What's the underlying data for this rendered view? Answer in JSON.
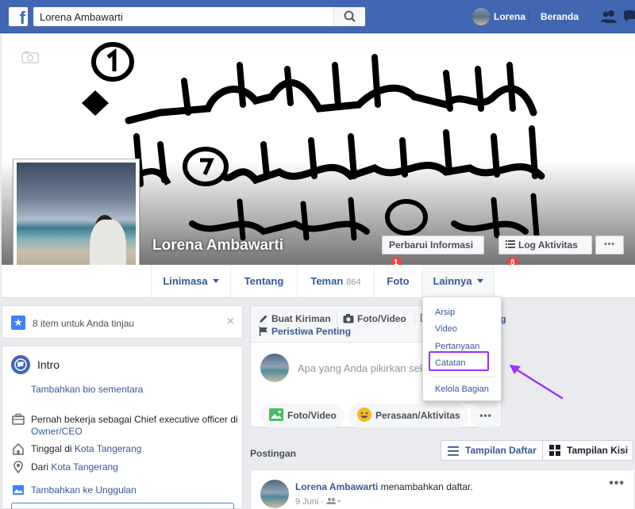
{
  "topbar": {
    "logo": "f",
    "search_value": "Lorena Ambawarti",
    "user_name": "Lorena",
    "home_label": "Beranda"
  },
  "cover": {
    "name": "Lorena Ambawarti",
    "update_info_label": "Perbarui Informasi",
    "update_info_badge": "1",
    "activity_log_label": "Log Aktivitas",
    "activity_log_badge": "8",
    "more_label": "•••"
  },
  "tabs": {
    "timeline": "Linimasa",
    "about": "Tentang",
    "friends": "Teman",
    "friends_count": "864",
    "photos": "Foto",
    "more": "Lainnya"
  },
  "dropdown": {
    "items": [
      "Arsip",
      "Video",
      "Pertanyaan",
      "Catatan"
    ],
    "manage": "Kelola Bagian"
  },
  "review": {
    "text": "8 item untuk Anda tinjau",
    "close": "×"
  },
  "intro": {
    "title": "Intro",
    "add_bio": "Tambahkan bio sementara",
    "work_prefix": "Pernah bekerja sebagai Chief executive officer di",
    "work_link": "Owner/CEO",
    "lives_prefix": "Tinggal di ",
    "lives_link": "Kota Tangerang",
    "from_prefix": "Dari ",
    "from_link": "Kota Tangerang",
    "add_featured": "Tambahkan ke Unggulan"
  },
  "composer": {
    "create_post": "Buat Kiriman",
    "photo_video": "Foto/Video",
    "partial_tail": "ng",
    "life_event": "Peristiwa Penting",
    "placeholder": "Apa yang Anda pikirkan seka",
    "btn_photo": "Foto/Video",
    "btn_feeling": "Perasaan/Aktivitas",
    "btn_more": "•••"
  },
  "posts": {
    "label": "Postingan",
    "list_view": "Tampilan Daftar",
    "grid_view": "Tampilan Kisi"
  },
  "post": {
    "author": "Lorena Ambawarti",
    "action": " menambahkan daftar.",
    "date": "9 Juni ·",
    "more": "•••"
  },
  "colors": {
    "brand_blue": "#4267b2",
    "link_blue": "#365899",
    "highlight_purple": "#9b30ff",
    "badge_red": "#fa3e3e"
  }
}
